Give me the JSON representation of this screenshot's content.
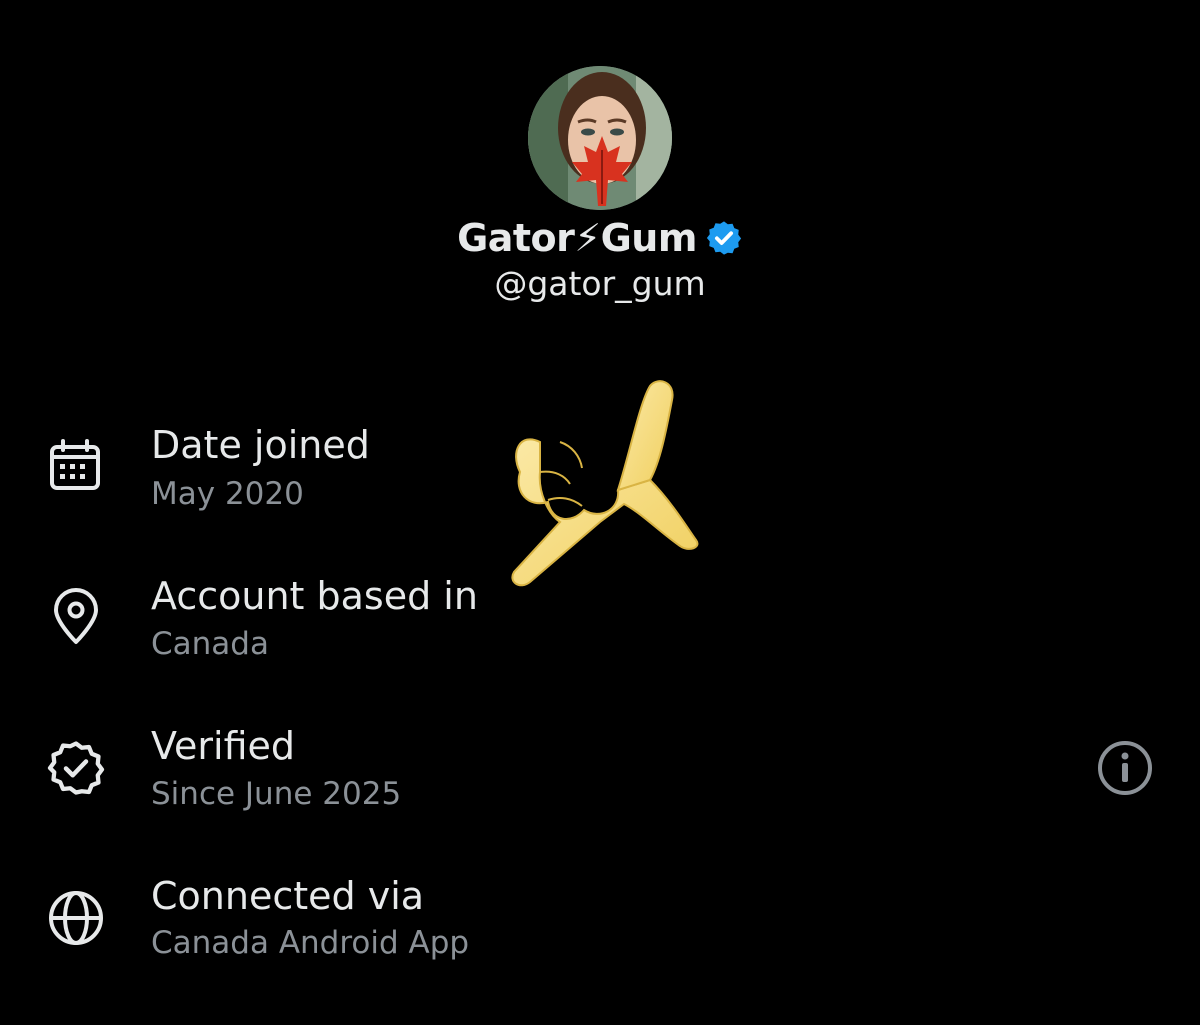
{
  "profile": {
    "display_name": "Gator⚡Gum",
    "handle": "@gator_gum",
    "verified_badge_color": "#1d9bf0"
  },
  "details": [
    {
      "icon": "calendar-icon",
      "label": "Date joined",
      "value": "May 2020"
    },
    {
      "icon": "location-pin-icon",
      "label": "Account based in",
      "value": "Canada"
    },
    {
      "icon": "verified-badge-icon",
      "label": "Verified",
      "value": "Since June 2025"
    },
    {
      "icon": "globe-icon",
      "label": "Connected via",
      "value": "Canada Android App"
    }
  ],
  "colors": {
    "background": "#000000",
    "primary_text": "#e7e9ea",
    "secondary_text": "#8b9197",
    "icon": "#e7e9ea"
  }
}
